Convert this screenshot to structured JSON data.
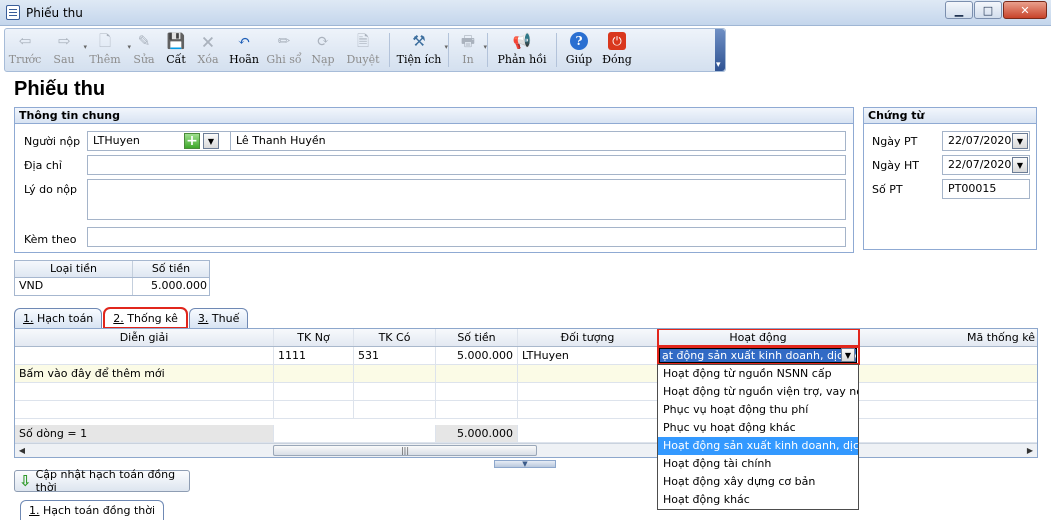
{
  "window": {
    "title": "Phiếu thu"
  },
  "toolbar": {
    "items": [
      {
        "label": "Trước",
        "icon": "back-arrow-icon",
        "glyph": "⇦",
        "enabled": false
      },
      {
        "label": "Sau",
        "icon": "forward-arrow-icon",
        "glyph": "⇨",
        "enabled": false
      },
      {
        "label": "Thêm",
        "icon": "add-document-icon",
        "glyph": "🗋",
        "enabled": false
      },
      {
        "label": "Sửa",
        "icon": "edit-document-icon",
        "glyph": "✎",
        "enabled": false
      },
      {
        "label": "Cất",
        "icon": "save-icon",
        "glyph": "💾",
        "enabled": true
      },
      {
        "label": "Xóa",
        "icon": "delete-document-icon",
        "glyph": "🗙",
        "enabled": false
      },
      {
        "label": "Hoãn",
        "icon": "undo-icon",
        "glyph": "↶",
        "enabled": true
      },
      {
        "label": "Ghi sổ",
        "icon": "pencil-icon",
        "glyph": "✏",
        "enabled": false
      },
      {
        "label": "Nạp",
        "icon": "reload-icon",
        "glyph": "⟳",
        "enabled": false
      },
      {
        "label": "Duyệt",
        "icon": "approve-document-icon",
        "glyph": "🗎",
        "enabled": false
      },
      {
        "label": "Tiện ích",
        "icon": "tools-icon",
        "glyph": "⚒",
        "enabled": true
      },
      {
        "label": "In",
        "icon": "printer-icon",
        "glyph": "🖶",
        "enabled": false
      },
      {
        "label": "Phản hồi",
        "icon": "megaphone-icon",
        "glyph": "📢",
        "enabled": true
      },
      {
        "label": "Giúp",
        "icon": "help-icon",
        "glyph": "?",
        "enabled": true
      },
      {
        "label": "Đóng",
        "icon": "close-power-icon",
        "glyph": "⏻",
        "enabled": true
      }
    ]
  },
  "page": {
    "title": "Phiếu thu"
  },
  "general": {
    "header": "Thông tin chung",
    "payer_label": "Người nộp",
    "payer_code": "LTHuyen",
    "payer_name": "Lê Thanh Huyền",
    "address_label": "Địa chỉ",
    "address_value": "",
    "reason_label": "Lý do nộp",
    "reason_value": "",
    "attach_label": "Kèm theo",
    "attach_value": ""
  },
  "voucher": {
    "header": "Chứng từ",
    "date_pt_label": "Ngày PT",
    "date_pt": "22/07/2020",
    "date_ht_label": "Ngày HT",
    "date_ht": "22/07/2020",
    "number_label": "Số PT",
    "number": "PT00015"
  },
  "currency": {
    "col_currency": "Loại tiền",
    "col_amount": "Số tiền",
    "currency": "VND",
    "amount": "5.000.000"
  },
  "tabs": [
    {
      "num": "1.",
      "label": " Hạch toán"
    },
    {
      "num": "2.",
      "label": " Thống kê"
    },
    {
      "num": "3.",
      "label": " Thuế"
    }
  ],
  "grid": {
    "columns": [
      "Diễn giải",
      "TK Nợ",
      "TK Có",
      "Số tiền",
      "Đối tượng",
      "Hoạt động",
      "Mã thống kê"
    ],
    "row": {
      "description": "",
      "debit": "1111",
      "credit": "531",
      "amount": "5.000.000",
      "object": "LTHuyen",
      "activity": "ạt động sản xuất kinh doanh, dịch vụ"
    },
    "add_row_text": "Bấm vào đây để thêm mới",
    "row_count_text": "Số dòng = 1",
    "total_amount": "5.000.000"
  },
  "activity_options": [
    "Hoạt động từ nguồn NSNN cấp",
    "Hoạt động từ nguồn viện trợ, vay nợ n",
    "Phục vụ hoạt động thu phí",
    "Phục vụ hoạt động khác",
    "Hoạt động sản xuất kinh doanh, dịch v",
    "Hoạt động tài chính",
    "Hoạt động xây dựng cơ bản",
    "Hoạt động khác"
  ],
  "selected_option_index": 4,
  "update_button": "Cập nhật hạch toán đồng thời",
  "bottom_tab": {
    "num": "1.",
    "label": " Hạch toán đồng thời"
  },
  "colors": {
    "highlight_border": "#e1261c",
    "selection": "#3399ff",
    "accent": "#316ac5"
  }
}
